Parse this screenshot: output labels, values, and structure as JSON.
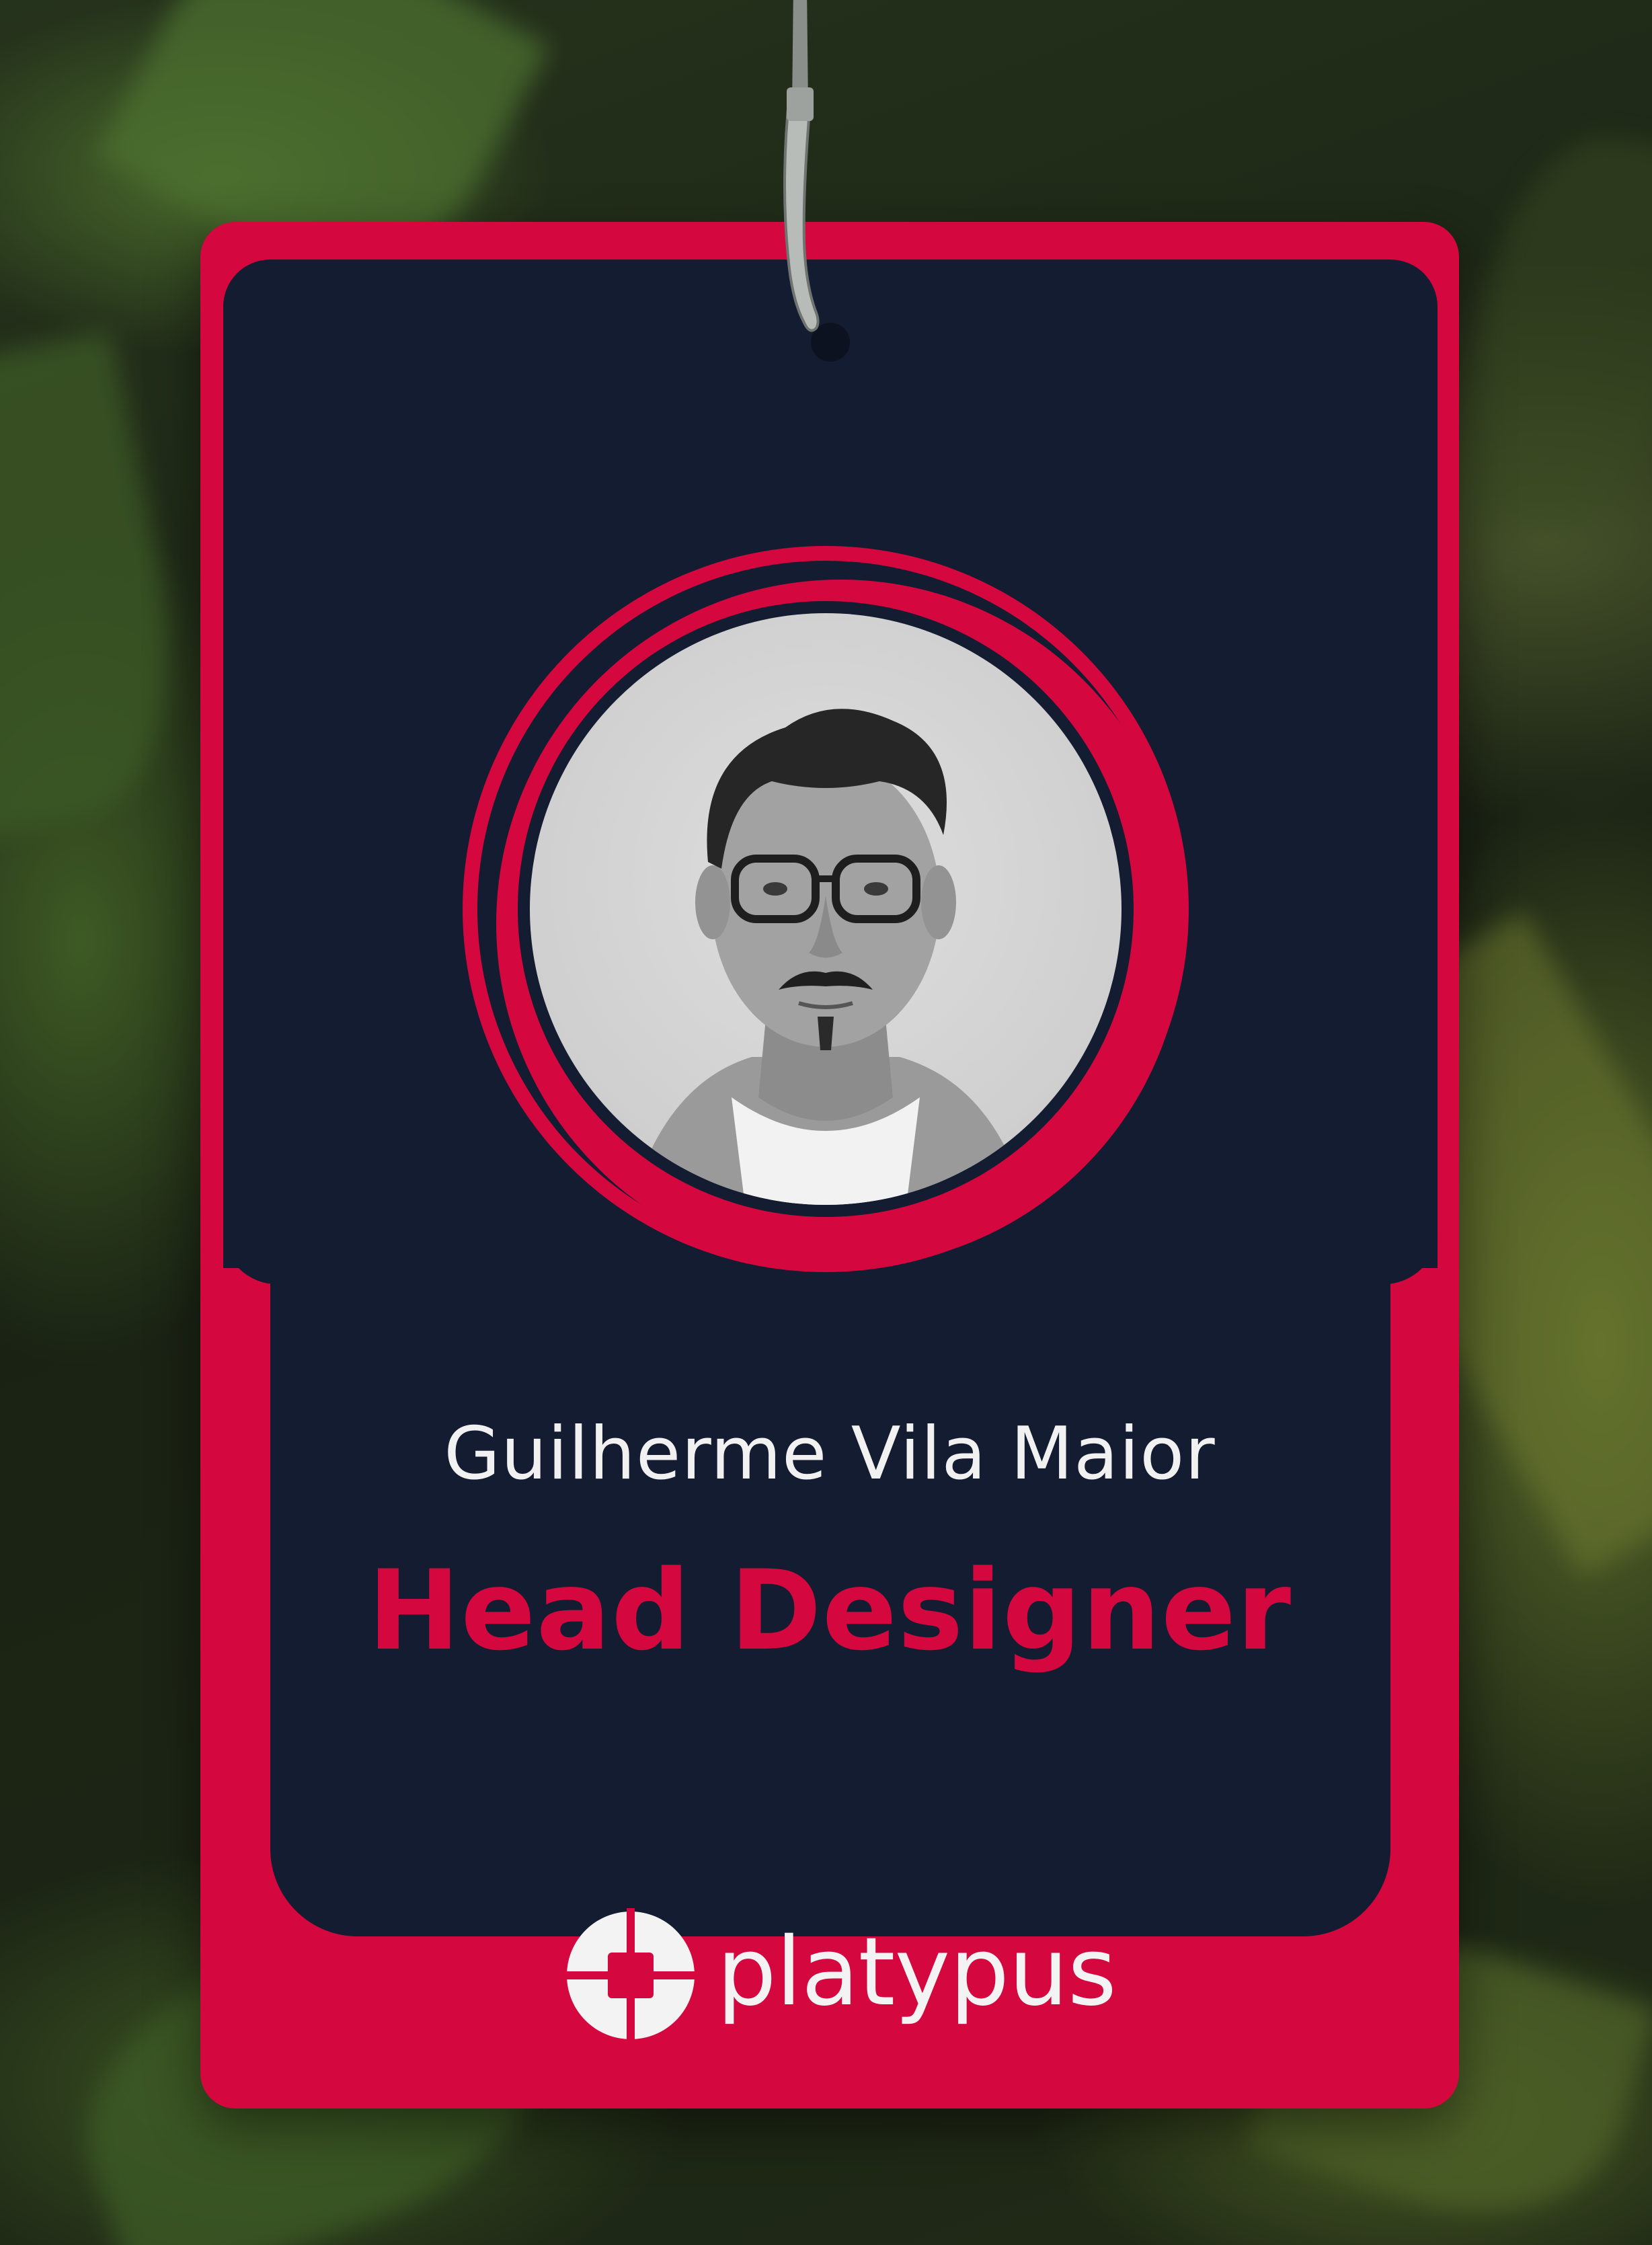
{
  "badge": {
    "name": "Guilherme Vila Maior",
    "role": "Head Designer",
    "brand": "platypus"
  },
  "colors": {
    "badge_red": "#d4073f",
    "badge_navy": "#131c31",
    "text_light": "#f1f1f1"
  },
  "icons": {
    "logo_mark": "platypus-logo-icon",
    "clip": "lanyard-clip-icon"
  }
}
